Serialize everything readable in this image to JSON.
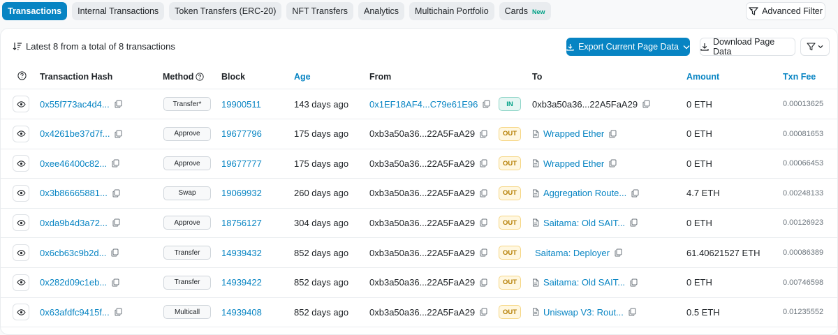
{
  "tabs": [
    {
      "label": "Transactions",
      "active": true
    },
    {
      "label": "Internal Transactions",
      "active": false
    },
    {
      "label": "Token Transfers (ERC-20)",
      "active": false
    },
    {
      "label": "NFT Transfers",
      "active": false
    },
    {
      "label": "Analytics",
      "active": false
    },
    {
      "label": "Multichain Portfolio",
      "active": false
    },
    {
      "label": "Cards",
      "active": false,
      "badge": "New"
    }
  ],
  "advanced_filter_label": "Advanced Filter",
  "summary": "Latest 8 from a total of 8 transactions",
  "export_label": "Export Current Page Data",
  "download_label": "Download Page Data",
  "columns": {
    "hash": "Transaction Hash",
    "method": "Method",
    "block": "Block",
    "age": "Age",
    "from": "From",
    "to": "To",
    "amount": "Amount",
    "fee": "Txn Fee"
  },
  "colors": {
    "accent": "#0784c3",
    "in": "#00a186",
    "out": "#b47d00"
  },
  "rows": [
    {
      "hash": "0x55f773ac4d4...",
      "method": "Transfer*",
      "block": "19900511",
      "age": "143 days ago",
      "from": "0x1EF18AF4...C79e61E96",
      "from_link": true,
      "dir": "IN",
      "to": "0xb3a50a36...22A5FaA29",
      "to_link": false,
      "to_contract": false,
      "amount": "0 ETH",
      "fee": "0.00013625"
    },
    {
      "hash": "0x4261be37d7f...",
      "method": "Approve",
      "block": "19677796",
      "age": "175 days ago",
      "from": "0xb3a50a36...22A5FaA29",
      "from_link": false,
      "dir": "OUT",
      "to": "Wrapped Ether",
      "to_link": true,
      "to_contract": true,
      "amount": "0 ETH",
      "fee": "0.00081653"
    },
    {
      "hash": "0xee46400c82...",
      "method": "Approve",
      "block": "19677777",
      "age": "175 days ago",
      "from": "0xb3a50a36...22A5FaA29",
      "from_link": false,
      "dir": "OUT",
      "to": "Wrapped Ether",
      "to_link": true,
      "to_contract": true,
      "amount": "0 ETH",
      "fee": "0.00066453"
    },
    {
      "hash": "0x3b86665881...",
      "method": "Swap",
      "block": "19069932",
      "age": "260 days ago",
      "from": "0xb3a50a36...22A5FaA29",
      "from_link": false,
      "dir": "OUT",
      "to": "Aggregation Route...",
      "to_link": true,
      "to_contract": true,
      "amount": "4.7 ETH",
      "fee": "0.00248133"
    },
    {
      "hash": "0xda9b4d3a72...",
      "method": "Approve",
      "block": "18756127",
      "age": "304 days ago",
      "from": "0xb3a50a36...22A5FaA29",
      "from_link": false,
      "dir": "OUT",
      "to": "Saitama: Old SAIT...",
      "to_link": true,
      "to_contract": true,
      "amount": "0 ETH",
      "fee": "0.00126923"
    },
    {
      "hash": "0x6cb63c9b2d...",
      "method": "Transfer",
      "block": "14939432",
      "age": "852 days ago",
      "from": "0xb3a50a36...22A5FaA29",
      "from_link": false,
      "dir": "OUT",
      "to": "Saitama: Deployer",
      "to_link": true,
      "to_contract": false,
      "amount": "61.40621527 ETH",
      "fee": "0.00086389"
    },
    {
      "hash": "0x282d09c1eb...",
      "method": "Transfer",
      "block": "14939422",
      "age": "852 days ago",
      "from": "0xb3a50a36...22A5FaA29",
      "from_link": false,
      "dir": "OUT",
      "to": "Saitama: Old SAIT...",
      "to_link": true,
      "to_contract": true,
      "amount": "0 ETH",
      "fee": "0.00746598"
    },
    {
      "hash": "0x63afdfc9415f...",
      "method": "Multicall",
      "block": "14939408",
      "age": "852 days ago",
      "from": "0xb3a50a36...22A5FaA29",
      "from_link": false,
      "dir": "OUT",
      "to": "Uniswap V3: Rout...",
      "to_link": true,
      "to_contract": true,
      "amount": "0.5 ETH",
      "fee": "0.01235552"
    }
  ]
}
